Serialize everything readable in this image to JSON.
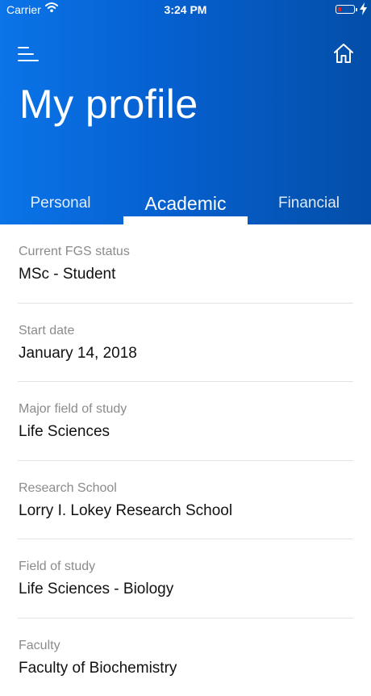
{
  "status_bar": {
    "carrier": "Carrier",
    "time": "3:24 PM",
    "battery_color": "#e0261b"
  },
  "header": {
    "title": "My profile",
    "menu_icon": "hamburger-menu-icon",
    "home_icon": "home-icon",
    "gradient_colors": [
      "#0a74e8",
      "#034ea8"
    ]
  },
  "tabs": [
    {
      "label": "Personal",
      "active": false
    },
    {
      "label": "Academic",
      "active": true
    },
    {
      "label": "Financial",
      "active": false
    }
  ],
  "fields": [
    {
      "label": "Current FGS status",
      "value": "MSc - Student"
    },
    {
      "label": "Start date",
      "value": "January 14, 2018"
    },
    {
      "label": "Major field of study",
      "value": "Life Sciences"
    },
    {
      "label": "Research School",
      "value": "Lorry I. Lokey Research School"
    },
    {
      "label": "Field of study",
      "value": "Life Sciences - Biology"
    },
    {
      "label": "Faculty",
      "value": "Faculty of Biochemistry"
    }
  ]
}
